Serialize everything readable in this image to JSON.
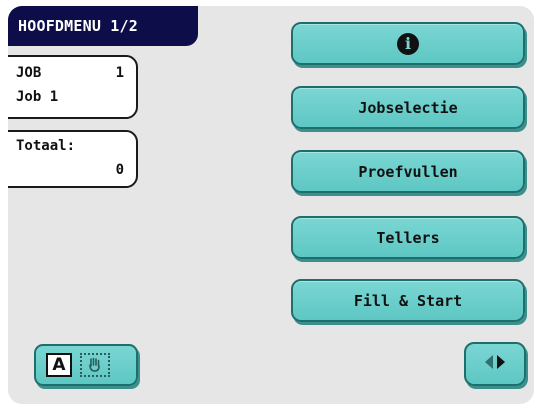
{
  "header": {
    "title": "HOOFDMENU 1/2"
  },
  "job": {
    "label": "JOB",
    "number": "1",
    "name": "Job 1"
  },
  "total": {
    "label": "Totaal:",
    "value": "0"
  },
  "menu": {
    "info_icon": "info-icon",
    "items": [
      {
        "label": "Jobselectie"
      },
      {
        "label": "Proefvullen"
      },
      {
        "label": "Tellers"
      },
      {
        "label": "Fill & Start"
      }
    ]
  },
  "mode": {
    "active_label": "A",
    "inactive_icon": "hand-icon"
  },
  "nav": {
    "icon": "page-toggle-arrows-icon"
  },
  "colors": {
    "header_bg": "#0d0d4a",
    "button_fill": "#6ecfcc",
    "screen_bg": "#e6e6e6"
  }
}
